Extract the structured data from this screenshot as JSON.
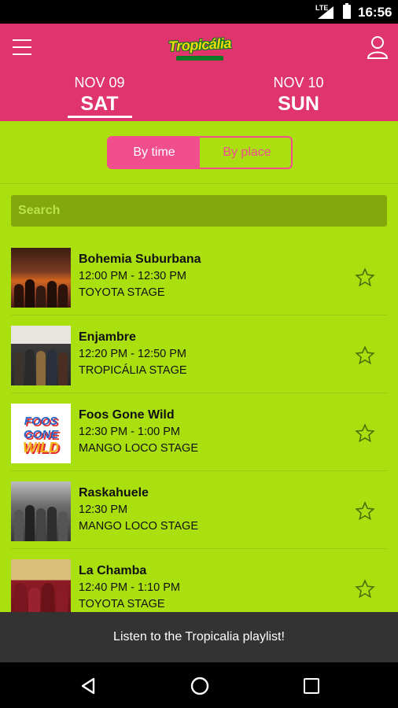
{
  "status_bar": {
    "network": "LTE",
    "time": "16:56"
  },
  "header": {
    "logo_text": "Tropicália"
  },
  "days": [
    {
      "date": "NOV 09",
      "day": "SAT",
      "selected": true
    },
    {
      "date": "NOV 10",
      "day": "SUN",
      "selected": false
    }
  ],
  "view_toggle": {
    "by_time": "By time",
    "by_place": "By place",
    "selected": "By time"
  },
  "search": {
    "placeholder": "Search"
  },
  "colors": {
    "header": "#e0346f",
    "background": "#aadf10",
    "accent": "#f04e8d"
  },
  "events": [
    {
      "name": "Bohemia Suburbana",
      "time": "12:00 PM - 12:30 PM",
      "stage": "TOYOTA STAGE",
      "icon": "star-outline-icon"
    },
    {
      "name": "Enjambre",
      "time": "12:20 PM - 12:50 PM",
      "stage": "TROPICÁLIA STAGE",
      "icon": "star-outline-icon"
    },
    {
      "name": "Foos Gone Wild",
      "time": "12:30 PM - 1:00 PM",
      "stage": "MANGO LOCO STAGE",
      "icon": "star-outline-icon",
      "thumb_text": [
        "FOOS GONE",
        "WILD"
      ]
    },
    {
      "name": "Raskahuele",
      "time": "12:30 PM",
      "stage": "MANGO LOCO STAGE",
      "icon": "star-outline-icon"
    },
    {
      "name": "La Chamba",
      "time": "12:40 PM - 1:10 PM",
      "stage": "TOYOTA STAGE",
      "icon": "star-outline-icon"
    }
  ],
  "playlist_banner": {
    "label": "Listen to the Tropicalia playlist!"
  }
}
